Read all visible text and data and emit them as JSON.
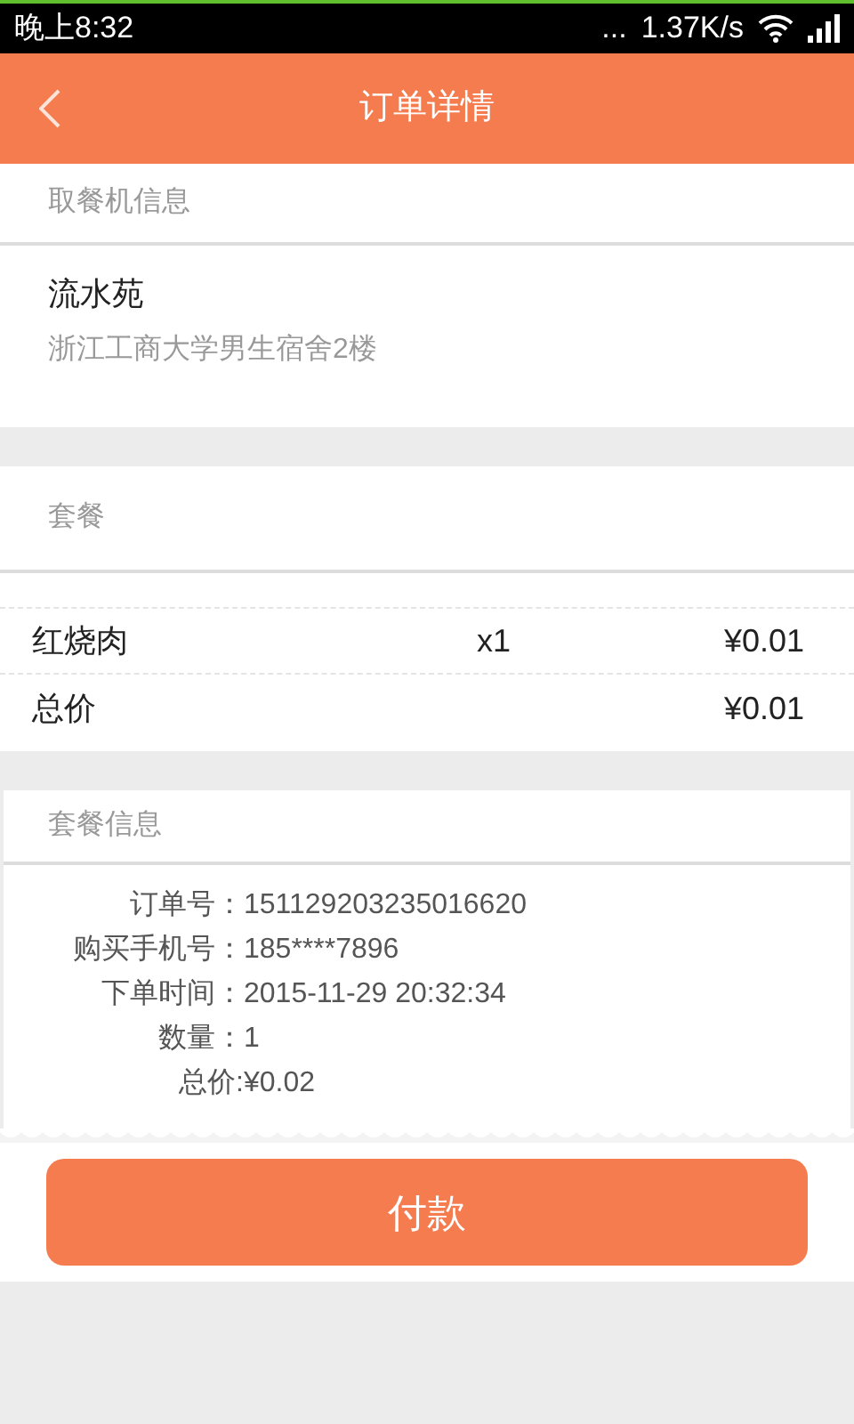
{
  "status_bar": {
    "time": "晚上8:32",
    "dots": "...",
    "speed": "1.37K/s"
  },
  "header": {
    "title": "订单详情"
  },
  "machine": {
    "heading": "取餐机信息",
    "name": "流水苑",
    "address": "浙江工商大学男生宿舍2楼"
  },
  "meal": {
    "heading": "套餐",
    "items": [
      {
        "name": "红烧肉",
        "qty": "x1",
        "price": "¥0.01"
      }
    ],
    "total_label": "总价",
    "total": "¥0.01"
  },
  "info": {
    "heading": "套餐信息",
    "rows": [
      {
        "label": "订单号：",
        "value": "151129203235016620"
      },
      {
        "label": "购买手机号：",
        "value": "185****7896"
      },
      {
        "label": "下单时间：",
        "value": "2015-11-29 20:32:34"
      },
      {
        "label": "数量：",
        "value": "1"
      },
      {
        "label": "总价: ",
        "value": "¥0.02"
      }
    ]
  },
  "pay_button": "付款"
}
